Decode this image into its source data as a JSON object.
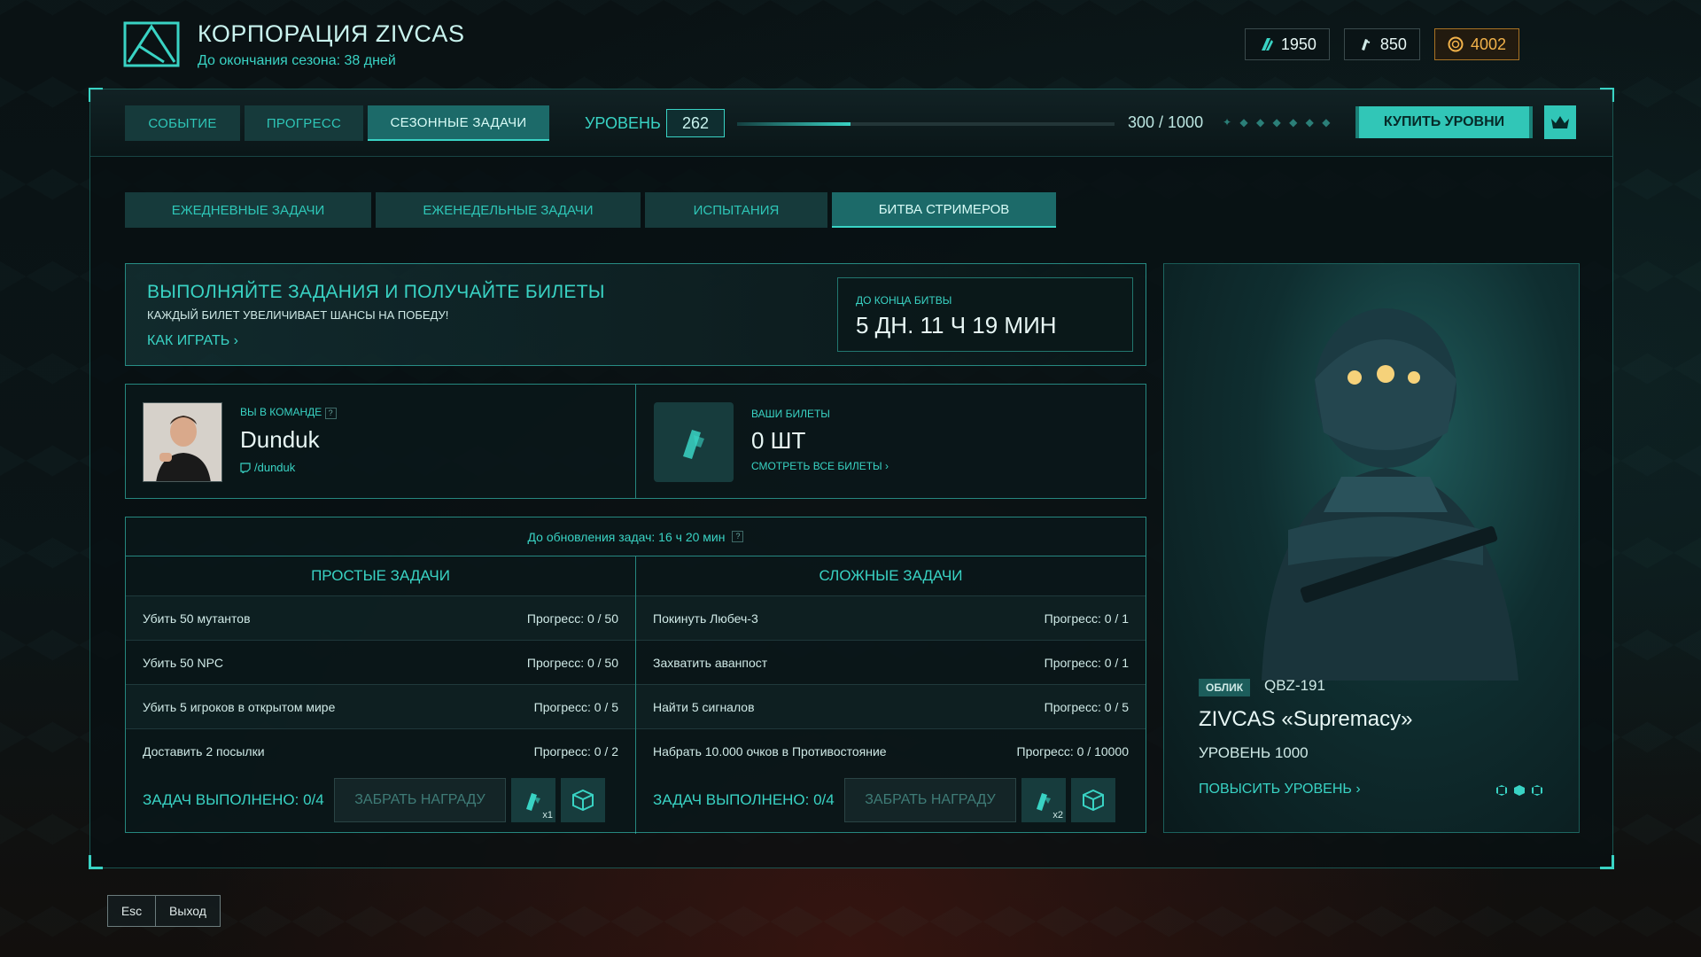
{
  "header": {
    "title": "КОРПОРАЦИЯ ZIVCAS",
    "subtitle": "До окончания сезона: 38 дней"
  },
  "currencies": [
    {
      "icon": "premium-currency-icon",
      "value": "1950"
    },
    {
      "icon": "ticket-currency-icon",
      "value": "850"
    },
    {
      "icon": "gold-coin-icon",
      "value": "4002"
    }
  ],
  "main_tabs": [
    {
      "label": "СОБЫТИЕ"
    },
    {
      "label": "ПРОГРЕСС"
    },
    {
      "label": "СЕЗОННЫЕ ЗАДАЧИ"
    }
  ],
  "level": {
    "label": "УРОВЕНЬ",
    "value": "262",
    "xp_text": "300 / 1000",
    "progress": 0.3,
    "buy_label": "КУПИТЬ УРОВНИ"
  },
  "sub_tabs": [
    {
      "label": "ЕЖЕДНЕВНЫЕ ЗАДАЧИ"
    },
    {
      "label": "ЕЖЕНЕДЕЛЬНЫЕ ЗАДАЧИ"
    },
    {
      "label": "ИСПЫТАНИЯ"
    },
    {
      "label": "БИТВА СТРИМЕРОВ"
    }
  ],
  "banner": {
    "title": "ВЫПОЛНЯЙТЕ ЗАДАНИЯ И ПОЛУЧАЙТЕ БИЛЕТЫ",
    "subtitle": "КАЖДЫЙ БИЛЕТ УВЕЛИЧИВАЕТ ШАНСЫ НА ПОБЕДУ!",
    "how_to_play": "КАК ИГРАТЬ ›",
    "timer_label": "ДО КОНЦА БИТВЫ",
    "timer_value": "5 ДН. 11 Ч 19 МИН"
  },
  "team": {
    "label": "ВЫ В КОМАНДЕ",
    "name": "Dunduk",
    "handle": "/dunduk"
  },
  "tickets": {
    "label": "ВАШИ БИЛЕТЫ",
    "count": "0 ШТ",
    "view_all": "СМОТРЕТЬ ВСЕ БИЛЕТЫ ›"
  },
  "tasks": {
    "update_text": "До обновления задач: 16 ч 20 мин",
    "simple": {
      "title": "ПРОСТЫЕ ЗАДАЧИ",
      "items": [
        {
          "name": "Убить 50 мутантов",
          "progress": "Прогресс: 0 / 50"
        },
        {
          "name": "Убить 50 NPC",
          "progress": "Прогресс: 0 / 50"
        },
        {
          "name": "Убить 5 игроков в открытом мире",
          "progress": "Прогресс: 0 / 5"
        },
        {
          "name": "Доставить 2 посылки",
          "progress": "Прогресс: 0 / 2"
        }
      ],
      "done": "ЗАДАЧ ВЫПОЛНЕНО: 0/4",
      "claim": "ЗАБРАТЬ НАГРАДУ",
      "reward_count": "x1"
    },
    "hard": {
      "title": "СЛОЖНЫЕ ЗАДАЧИ",
      "items": [
        {
          "name": "Покинуть Любеч-3",
          "progress": "Прогресс: 0 / 1"
        },
        {
          "name": "Захватить аванпост",
          "progress": "Прогресс: 0 / 1"
        },
        {
          "name": "Найти 5 сигналов",
          "progress": "Прогресс: 0 / 5"
        },
        {
          "name": "Набрать 10.000 очков в Противостояние",
          "progress": "Прогресс: 0 / 10000"
        }
      ],
      "done": "ЗАДАЧ ВЫПОЛНЕНО: 0/4",
      "claim": "ЗАБРАТЬ НАГРАДУ",
      "reward_count": "x2"
    }
  },
  "skin": {
    "badge": "ОБЛИК",
    "code": "QBZ-191",
    "name": "ZIVCAS «Supremacy»",
    "level": "УРОВЕНЬ 1000",
    "upgrade": "ПОВЫСИТЬ УРОВЕНЬ ›"
  },
  "footer": {
    "esc": "Esc",
    "exit": "Выход"
  },
  "colors": {
    "accent": "#39d3c4",
    "gold": "#f2b24a"
  }
}
